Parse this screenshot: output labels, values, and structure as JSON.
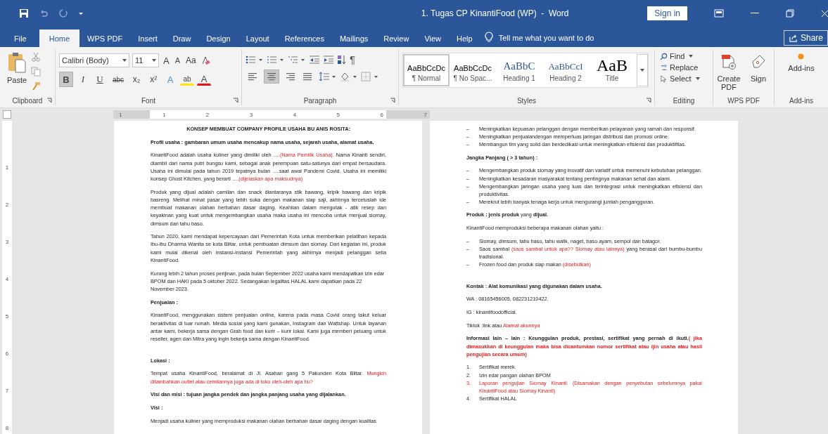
{
  "title_bar": {
    "title": "1. Tugas CP KinantiFood (WP)  -  Word",
    "sign_in": "Sign in"
  },
  "tabs": [
    {
      "label": "File",
      "selected": false
    },
    {
      "label": "Home",
      "selected": true
    },
    {
      "label": "WPS PDF",
      "selected": false
    },
    {
      "label": "Insert",
      "selected": false
    },
    {
      "label": "Draw",
      "selected": false
    },
    {
      "label": "Design",
      "selected": false
    },
    {
      "label": "Layout",
      "selected": false
    },
    {
      "label": "References",
      "selected": false
    },
    {
      "label": "Mailings",
      "selected": false
    },
    {
      "label": "Review",
      "selected": false
    },
    {
      "label": "View",
      "selected": false
    },
    {
      "label": "Help",
      "selected": false
    }
  ],
  "tell_me": "Tell me what you want to do",
  "share": "Share",
  "ribbon": {
    "clipboard": {
      "paste": "Paste",
      "label": "Clipboard"
    },
    "font": {
      "name": "Calibri (Body)",
      "size": "11",
      "label": "Font",
      "row1": [
        {
          "label": "A",
          "kind": "grow"
        },
        {
          "label": "A",
          "kind": "shrink"
        },
        {
          "label": "Aa",
          "kind": "case"
        }
      ],
      "row2": [
        {
          "label": "B",
          "kind": "bold",
          "selected": true
        },
        {
          "label": "I",
          "kind": "italic",
          "selected": false
        },
        {
          "label": "U",
          "kind": "underline",
          "selected": false
        },
        {
          "label": "abc",
          "kind": "strike",
          "selected": false
        },
        {
          "label": "x₂",
          "kind": "sub",
          "selected": false
        },
        {
          "label": "x²",
          "kind": "sup",
          "selected": false
        },
        {
          "label": "A",
          "kind": "effects",
          "selected": false
        },
        {
          "label": "ab",
          "kind": "highlight",
          "selected": false
        },
        {
          "label": "A",
          "kind": "color",
          "selected": false
        }
      ]
    },
    "paragraph": {
      "marks": "¶",
      "label": "Paragraph",
      "alignment": [
        {
          "kind": "left",
          "selected": false
        },
        {
          "kind": "center",
          "selected": true
        },
        {
          "kind": "right",
          "selected": false
        },
        {
          "kind": "justify",
          "selected": false
        }
      ]
    },
    "styles": {
      "label": "Styles",
      "items": [
        {
          "preview": "AaBbCcDc",
          "name": "¶ Normal",
          "kind": "normal",
          "selected": true
        },
        {
          "preview": "AaBbCcDc",
          "name": "¶ No Spac...",
          "kind": "nospace",
          "selected": false
        },
        {
          "preview": "AaBbC",
          "name": "Heading 1",
          "kind": "heading1",
          "selected": false
        },
        {
          "preview": "AaBbCcI",
          "name": "Heading 2",
          "kind": "heading2",
          "selected": false
        },
        {
          "preview": "AaB",
          "name": "Title",
          "kind": "title",
          "selected": false
        }
      ]
    },
    "editing": {
      "find": "Find",
      "replace": "Replace",
      "select": "Select",
      "label": "Editing"
    },
    "wps_pdf": {
      "create": "Create PDF",
      "sign": "Sign",
      "label": "WPS PDF"
    },
    "addins": {
      "button": "Add-ins",
      "label": "Add-ins"
    }
  },
  "ruler": {
    "marks": [
      "1",
      "1",
      "2",
      "3",
      "4",
      "5",
      "6",
      "7"
    ]
  },
  "vertical_ruler": {
    "marks": [
      "1",
      "2",
      "3",
      "4",
      "5",
      "6",
      "7",
      "8"
    ]
  },
  "pages": [
    {
      "blocks": [
        {
          "kind": "heading",
          "runs": [
            {
              "text": "KONSEP MEMBUAT COMPANY PROFILE  USAHA BU ANIS ROSITA:",
              "kind": "bold"
            }
          ]
        },
        {
          "kind": "text",
          "runs": [
            {
              "text": "Profil usaha : gambaran umum usaha mencakup nama usaha, sejarah usaha, alamat usaha.",
              "kind": "bold"
            }
          ]
        },
        {
          "kind": "justified",
          "runs": [
            {
              "text": "KinantiFood adalah usaha kuliner yang dimiliki oleh ….",
              "kind": "plain"
            },
            {
              "text": "(Nama Pemilik Usaha).",
              "kind": "red"
            },
            {
              "text": " Nama Kinanti sendiri, diambil dari nama putri bungsu kami, sebagai anak perempuan satu-satunya dari empat bersaudara. Usaha ini dimulai pada tahun 2019 tepatnya bulan ….saat awal Pandemi Covid. Usaha ini memiliki konsep Ghost Kitchen, yang berarti ….",
              "kind": "plain"
            },
            {
              "text": "(dijelaskan apa maksudnya)",
              "kind": "red"
            }
          ]
        },
        {
          "kind": "justified",
          "runs": [
            {
              "text": "Produk yang dijual adalah camilan dan snack diantaranya stik bawang, kripik bawang dan kripik basreng. Melihat minat pasar yang lebih suka dengan makanan siap saji, akhirnya tercetuslah ide membuat makanan olahan berbahan dasar daging. Keahlian dalam mengutak - atik resep dan keyakinan yang kuat untuk mengembangkan usaha maka usaha ini mencoba untuk menjual siomay, dimsum dan tahu baso.",
              "kind": "plain"
            }
          ]
        },
        {
          "kind": "justified",
          "runs": [
            {
              "text": "Tahun 2020, kami mendapat kepercayaan dari Pemerintah Kota untuk memberikan pelatihan kepada Ibu-ibu Dharma Wanita se kota Blitar, untuk pembuatan dimsum dan siomay.  Dari kegiatan ini, produk kami mulai dikenal oleh instansi-instansi Pemerintah yang akhirnya menjadi pelanggan setia KinantiFood.",
              "kind": "plain"
            }
          ]
        },
        {
          "kind": "text",
          "runs": [
            {
              "text": "Kurang lebih 2 tahun proses perijinan, pada bulan September 2022 usaha kami mendapatkan izin edar BPOM dan HAKI pada 5 oktober 2022. Sedangakan legalitas HALAL kami dapatkan pada 22 November 2023.",
              "kind": "plain"
            }
          ]
        },
        {
          "kind": "text",
          "runs": [
            {
              "text": "Penjualan :",
              "kind": "bold"
            }
          ]
        },
        {
          "kind": "justified",
          "runs": [
            {
              "text": "KinantiFood,  menggunakan sistem penjualan online, karena pada masa Covid orang takut keluar beraktivitas di luar rumah. Media sosial yang kami gunakan, Instagram dan Wattshap. Untuk layanan antar kami, bekerja sama dengan Grab food dan kurir – kurir lokal. Kami juga memberi peluang untuk reseller, agen dan Mitra yang ingin bekerja sama dengan KinantiFood.",
              "kind": "plain"
            }
          ]
        },
        {
          "kind": "gap"
        },
        {
          "kind": "text",
          "runs": [
            {
              "text": "Lokasi :",
              "kind": "bold"
            }
          ]
        },
        {
          "kind": "justified",
          "runs": [
            {
              "text": "Tempat usaha KinantiFood,  beralamat di Jl. Asahan gang 5 Pakunden Kota Blitar. ",
              "kind": "plain"
            },
            {
              "text": "Mungkin ditambahkan outlet atau cemilannya juga ada di toko oleh-oleh apa bu?",
              "kind": "red"
            }
          ]
        },
        {
          "kind": "text",
          "runs": [
            {
              "text": "Visi dan misi : tujuan jangka pendek dan jangka panjang usaha yang dijalankan.",
              "kind": "bold"
            }
          ]
        },
        {
          "kind": "text",
          "runs": [
            {
              "text": "Visi :",
              "kind": "bold"
            }
          ]
        },
        {
          "kind": "text",
          "runs": [
            {
              "text": "Menjadi usaha kuliner yang memproduksi makanan olahan berbahan dasar daging dengan kualitas",
              "kind": "plain"
            }
          ]
        }
      ]
    },
    {
      "blocks": [
        {
          "kind": "item",
          "marker": "–",
          "runs": [
            {
              "text": "Meningkatkan kepuasan pelanggan dengan memberikan pelayanan yang ramah dan responsif.",
              "kind": "plain"
            }
          ]
        },
        {
          "kind": "item",
          "marker": "–",
          "runs": [
            {
              "text": "Meningkatkan penjualandengan memperluas jaringan distribusi dan promosi online.",
              "kind": "plain"
            }
          ]
        },
        {
          "kind": "item",
          "marker": "–",
          "runs": [
            {
              "text": "Membangun tim yang solid dan berdedikasi untuk meningkatkan efisiensi dan produktifitas.",
              "kind": "plain"
            }
          ]
        },
        {
          "kind": "text",
          "runs": [
            {
              "text": "Jangka Panjang ( > 3 tahun) :",
              "kind": "bold"
            }
          ]
        },
        {
          "kind": "item",
          "marker": "–",
          "runs": [
            {
              "text": "Mengembangkan produk siomay yang inovatif dan variatif untuk memenuhi kebutuhan pelanggan.",
              "kind": "plain"
            }
          ]
        },
        {
          "kind": "item",
          "marker": "–",
          "runs": [
            {
              "text": "Meningkatkan kesadaran masyarakat tentang pentingnya makanan sehat dan alami.",
              "kind": "plain"
            }
          ]
        },
        {
          "kind": "item",
          "marker": "–",
          "runs": [
            {
              "text": "Mengembangkan jaringan usaha yang luas dan terintegrasi untuk meningkatkan efisiensi dan produktivitas.",
              "kind": "plain"
            }
          ]
        },
        {
          "kind": "item",
          "marker": "–",
          "runs": [
            {
              "text": "Merekrut lebih banyak tenaga kerja untuk mengurangi jumlah pengangguran.",
              "kind": "plain"
            }
          ]
        },
        {
          "kind": "text",
          "runs": [
            {
              "text": "Produk : jenis produk",
              "kind": "bold"
            },
            {
              "text": " yang ",
              "kind": "plain"
            },
            {
              "text": "dijual.",
              "kind": "bold"
            }
          ]
        },
        {
          "kind": "text",
          "runs": [
            {
              "text": "KinantiFood memproduksi beberapa makanan olahan yaitu :",
              "kind": "plain"
            }
          ]
        },
        {
          "kind": "item",
          "marker": "–",
          "runs": [
            {
              "text": "Siomay, dimsum, tahu baso, tahu walik, naget, baso ayam, sempol dan batagor.",
              "kind": "plain"
            }
          ]
        },
        {
          "kind": "item",
          "marker": "–",
          "runs": [
            {
              "text": "Saos sambal ",
              "kind": "plain"
            },
            {
              "text": "(saos sambal untuk apa?? Siomay atau lainnya)",
              "kind": "red"
            },
            {
              "text": " yang berasal dari bumbu-bumbu tradisional.",
              "kind": "plain"
            }
          ]
        },
        {
          "kind": "item",
          "marker": "–",
          "runs": [
            {
              "text": "Frozen food dan produk siap makan ",
              "kind": "plain"
            },
            {
              "text": "(disebutkan)",
              "kind": "red"
            }
          ]
        },
        {
          "kind": "gap"
        },
        {
          "kind": "text",
          "runs": [
            {
              "text": "Kontak : Alat komunikasi yang digunakan dalam usaha.",
              "kind": "bold"
            }
          ]
        },
        {
          "kind": "text",
          "runs": [
            {
              "text": "WA : 08165456005, 082231210422.",
              "kind": "plain"
            }
          ]
        },
        {
          "kind": "text",
          "runs": [
            {
              "text": "IG : kinantifoodofficial.",
              "kind": "plain"
            }
          ]
        },
        {
          "kind": "text",
          "runs": [
            {
              "text": "Tiktok :link atau ",
              "kind": "plain"
            },
            {
              "text": "Alamat akunnya",
              "kind": "red"
            }
          ]
        },
        {
          "kind": "justified",
          "runs": [
            {
              "text": "Informasi lain – lain : Keunggulan produk, prestasi, sertifikat yang pernah di ikuti.",
              "kind": "bold"
            },
            {
              "text": "( jika dimasukkan di keunggulan maka bisa dicantumkan nomor sertifikat atau ijin usaha atau hasil pengujian secara umum)",
              "kind": "redbold"
            }
          ]
        },
        {
          "kind": "item",
          "marker": "1.",
          "runs": [
            {
              "text": "Sertifikat merek.",
              "kind": "plain"
            }
          ]
        },
        {
          "kind": "item",
          "marker": "2.",
          "runs": [
            {
              "text": "Izin edar pangan olahan BPOM",
              "kind": "plain"
            }
          ]
        },
        {
          "kind": "item",
          "marker": "3.",
          "runs": [
            {
              "text": "Laporan pengujian Siomay Kinanti. (Disamakan dengan penyebutan sebelumnya pakai KinantiFood atau Siomay Kinanti)",
              "kind": "red"
            }
          ]
        },
        {
          "kind": "item",
          "marker": "4.",
          "runs": [
            {
              "text": "Sertifikat HALAL",
              "kind": "plain"
            }
          ]
        }
      ]
    }
  ]
}
